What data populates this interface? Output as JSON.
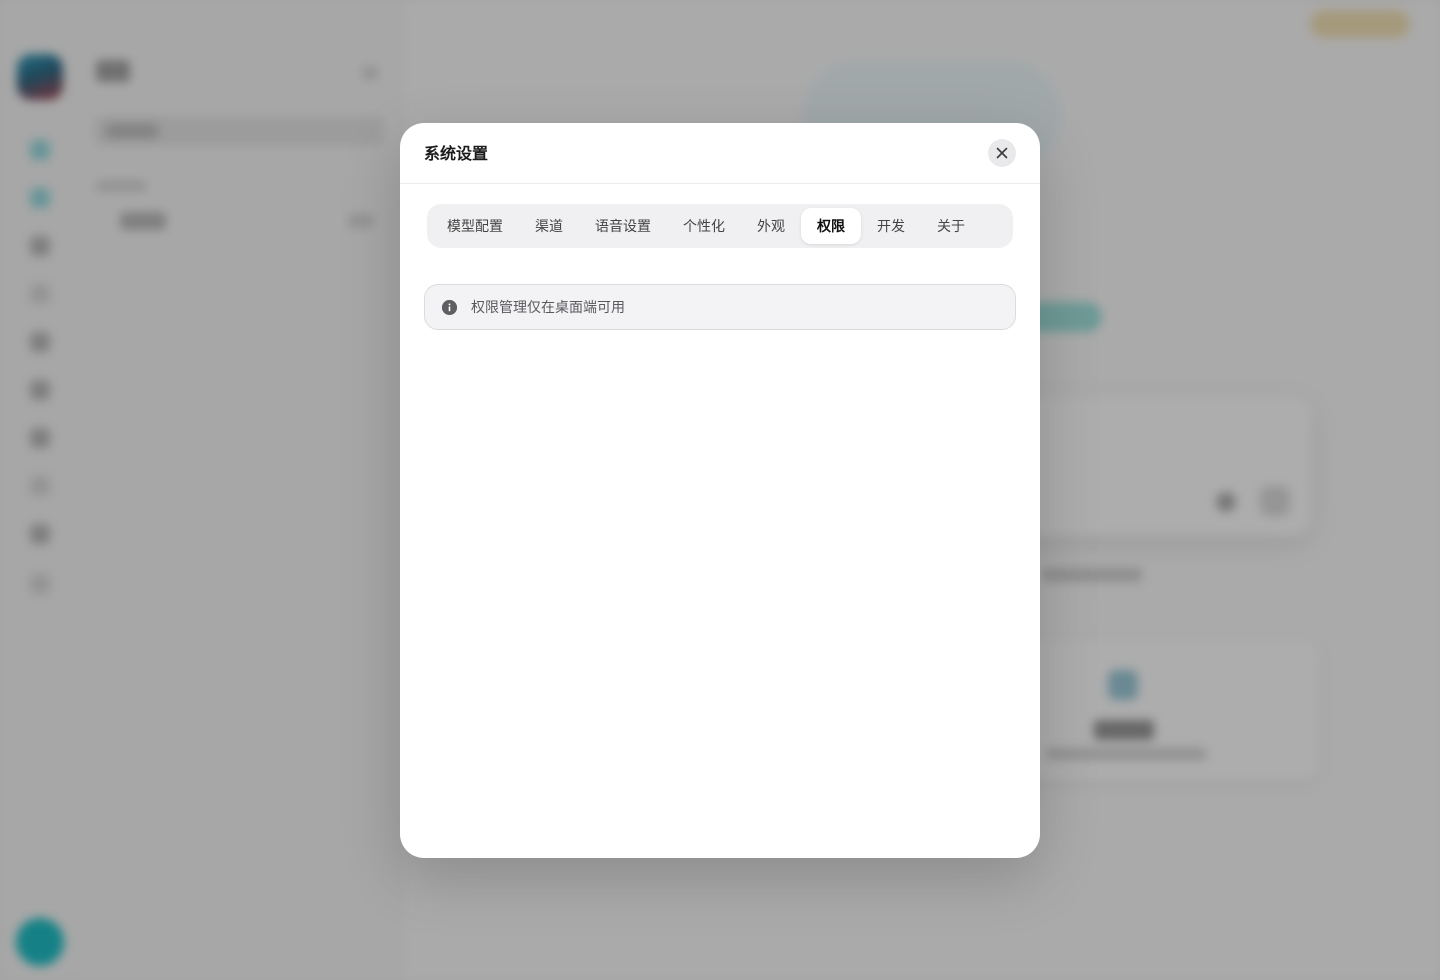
{
  "modal": {
    "title": "系统设置",
    "tabs": [
      {
        "label": "模型配置",
        "active": false
      },
      {
        "label": "渠道",
        "active": false
      },
      {
        "label": "语音设置",
        "active": false
      },
      {
        "label": "个性化",
        "active": false
      },
      {
        "label": "外观",
        "active": false
      },
      {
        "label": "权限",
        "active": true
      },
      {
        "label": "开发",
        "active": false
      },
      {
        "label": "关于",
        "active": false
      }
    ],
    "notice": {
      "icon": "info-icon",
      "text": "权限管理仅在桌面端可用"
    }
  },
  "colors": {
    "overlay": "rgba(0,0,0,0.32)",
    "accent": "#1fbfc6",
    "active_tab_bg": "#ffffff",
    "tabs_bg": "#f0f0f2"
  }
}
